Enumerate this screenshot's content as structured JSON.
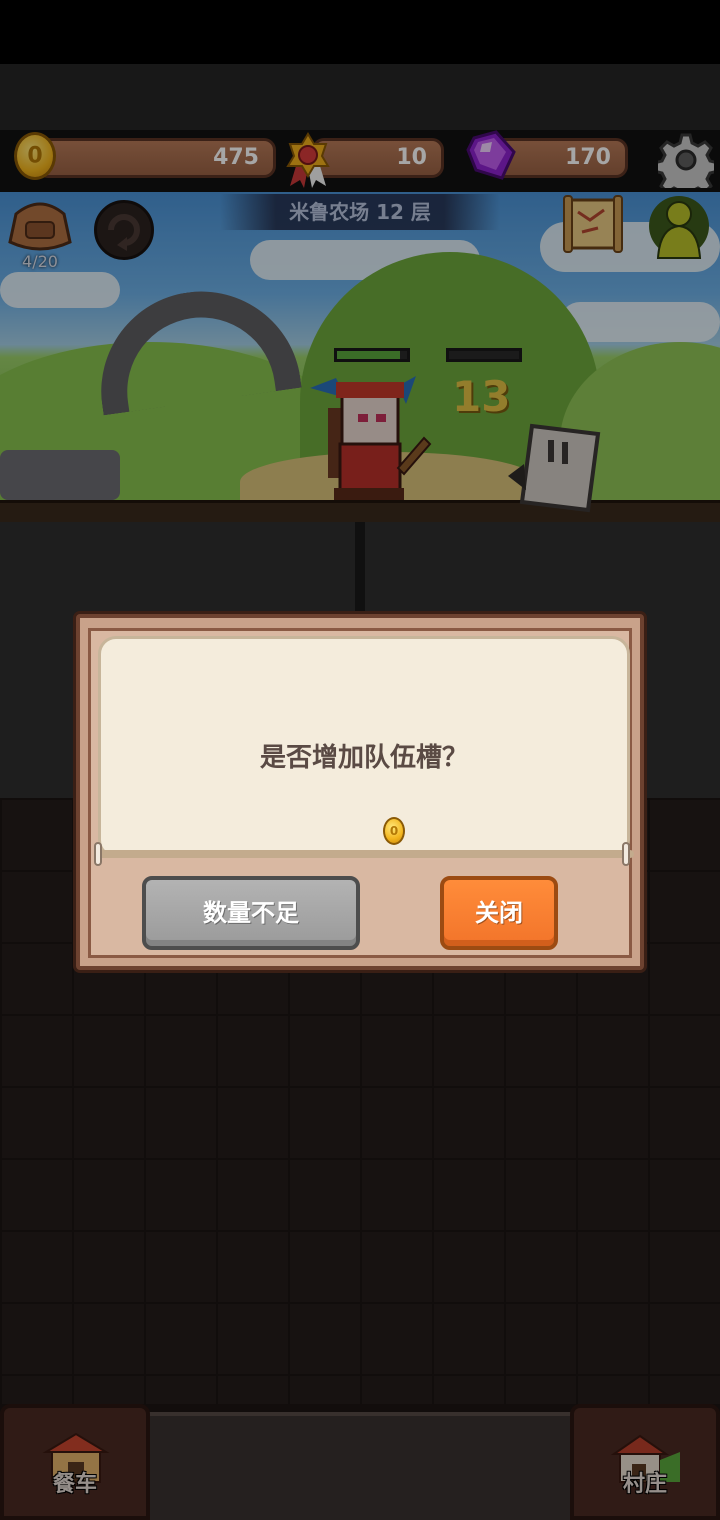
{
  "resources": {
    "gold": "475",
    "medals": "10",
    "gems": "170"
  },
  "stage": {
    "title": "米鲁农场 12 层",
    "bag_count": "4/20",
    "damage_number": "13",
    "hero_hp": 0.9,
    "enemy_hp": 0.0
  },
  "dialog": {
    "message": "是否增加队伍槽？",
    "cost_icon": "coin-icon",
    "insufficient_button": "数量不足",
    "close_button": "关闭"
  },
  "bottom_nav": {
    "left_label": "餐车",
    "right_label": "村庄"
  },
  "colors": {
    "gold": "#f3b51d",
    "gem": "#9b2bd6",
    "accent_orange": "#f2742a",
    "disabled_gray": "#9a9a9a"
  }
}
